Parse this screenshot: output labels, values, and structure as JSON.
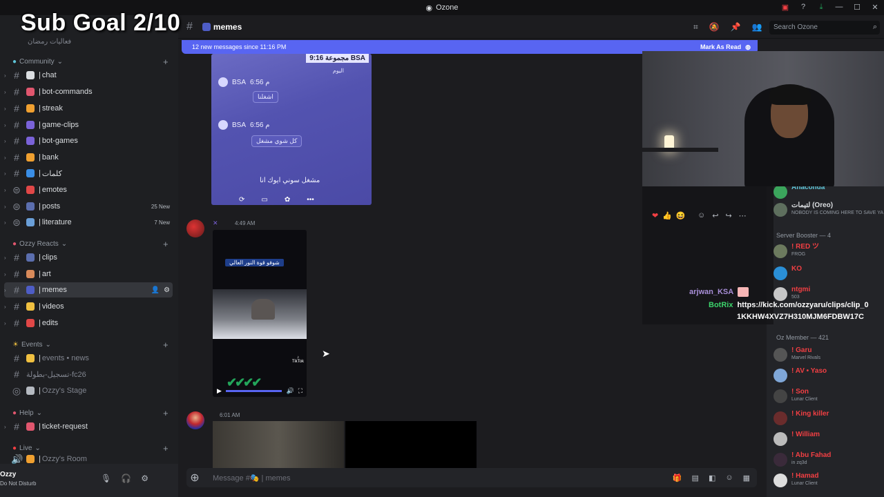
{
  "overlay": {
    "sub_goal": "Sub Goal 2/10"
  },
  "window": {
    "title": "Ozone"
  },
  "sidebar": {
    "scrolled_text": "فعاليات رمضان",
    "categories": [
      {
        "label": "Community"
      },
      {
        "label": "Ozzy Reacts"
      },
      {
        "label": "Events"
      },
      {
        "label": "Help"
      },
      {
        "label": "Live"
      }
    ],
    "channels": [
      {
        "name": "chat",
        "color": "#dbdee1"
      },
      {
        "name": "bot-commands",
        "color": "#e0566e"
      },
      {
        "name": "streak",
        "color": "#f0a030"
      },
      {
        "name": "game-clips",
        "color": "#7a62d8"
      },
      {
        "name": "bot-games",
        "color": "#7a62d8"
      },
      {
        "name": "bank",
        "color": "#f0a030"
      },
      {
        "name": "كلمات",
        "color": "#3a8ee6"
      },
      {
        "name": "emotes",
        "color": "#e04747"
      },
      {
        "name": "posts",
        "badge": "25 New",
        "color": "#5b6eae"
      },
      {
        "name": "literature",
        "badge": "7 New",
        "color": "#6a9fd8"
      },
      {
        "name": "clips",
        "color": "#5b6eae"
      },
      {
        "name": "art",
        "color": "#d88a5a"
      },
      {
        "name": "memes",
        "color": "#4e5dc6"
      },
      {
        "name": "videos",
        "color": "#f0c040"
      },
      {
        "name": "edits",
        "color": "#e04747"
      },
      {
        "name": "events • news",
        "color": "#f0c040"
      },
      {
        "name": "تسجيل-بطولة-fc26",
        "color": ""
      },
      {
        "name": "Ozzy's Stage",
        "color": "#b5bac1"
      },
      {
        "name": "ticket-request",
        "color": "#e0566e"
      },
      {
        "name": "Ozzy's Room",
        "color": "#f0a030"
      }
    ],
    "user": {
      "name": "Ozzy",
      "status": "Do Not Disturb"
    }
  },
  "header": {
    "channel": "memes",
    "search_placeholder": "Search Ozone"
  },
  "new_messages": {
    "text": "12 new messages since 11:16 PM",
    "mark_read": "Mark As Read"
  },
  "messages": {
    "image1": {
      "top_label": "9:16 مجموعة BSA",
      "rows": [
        {
          "name": "BSA",
          "time": "6:56 م",
          "bubble": "اشغلنا"
        },
        {
          "name": "BSA",
          "time": "6:56 م",
          "bubble": "كل شوي مشغل"
        }
      ],
      "bottom_text": "مشغل سوني ايوك انا",
      "day": "اليوم"
    },
    "msg2": {
      "time": "4:49 AM",
      "video_title": "شوفو قوة النور العالي",
      "tiktok": "TikTok"
    },
    "msg3": {
      "time": "6:01 AM"
    }
  },
  "composer": {
    "placeholder": "Message #🎭 | memes"
  },
  "stream_chat": {
    "line1_user": "arjwan_KSA",
    "line2_user": "BotRix",
    "line2_text_a": "https://kick.com/ozzyaru/clips/clip_0",
    "line2_text_b": "1KKHW4XVZ7H310MJM6FDBW17C"
  },
  "members": {
    "top": [
      {
        "name": "Anaconda",
        "sub": "",
        "color": "#5ec5d8"
      },
      {
        "name": "لتيمات (Oreo)",
        "sub": "NOBODY IS COMING HERE TO SAVE YA",
        "color": "#dbdee1"
      }
    ],
    "booster_group": "Server Booster — 4",
    "boosters": [
      {
        "name": "! RED ツ",
        "sub": "FROG",
        "color": "#f23f43"
      },
      {
        "name": "KO",
        "sub": "",
        "color": "#f23f43"
      },
      {
        "name": "ntgmi",
        "sub": "503",
        "color": "#f23f43"
      }
    ],
    "member_group": "Oz Member — 421",
    "rest": [
      {
        "name": "! Garu",
        "sub": "Marvel Rivals",
        "color": "#f23f43"
      },
      {
        "name": "! AV • Yaso",
        "sub": "",
        "color": "#f23f43"
      },
      {
        "name": "! Son",
        "sub": "Lunar Client",
        "color": "#f23f43"
      },
      {
        "name": "! King killer",
        "sub": "",
        "color": "#f23f43"
      },
      {
        "name": "! William",
        "sub": "",
        "color": "#f23f43"
      },
      {
        "name": "! Abu Fahad",
        "sub": "in zq3d",
        "color": "#f23f43"
      },
      {
        "name": "! Hamad",
        "sub": "Lunar Client",
        "color": "#f23f43"
      }
    ]
  }
}
